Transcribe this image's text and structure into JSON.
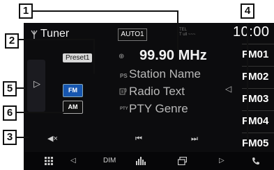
{
  "header": {
    "source_title": "Tuner",
    "auto_badge": "AUTO1",
    "status_line1": "TEL",
    "status_line2": "T ull ~~~",
    "clock": "10:00"
  },
  "main": {
    "preset_label": "Preset1",
    "frequency": "99.90 MHz",
    "ps_icon_label": "PS",
    "station_name": "Station Name",
    "radio_text": "Radio Text",
    "pty_icon_label": "PTY",
    "pty_genre": "PTY Genre"
  },
  "band_buttons": {
    "fm": "FM",
    "am": "AM"
  },
  "preset_list": {
    "items": [
      "FM01",
      "FM02",
      "FM03",
      "FM04",
      "FM05"
    ]
  },
  "controls": {
    "mute": "◀×",
    "prev": "⏮",
    "next": "⏭"
  },
  "bottom_bar": {
    "dim_label": "DIM"
  },
  "callouts": [
    "1",
    "2",
    "3",
    "4",
    "5",
    "6"
  ],
  "colors": {
    "band_active": "#1656b0",
    "screen_bg": "#0c0c0e"
  }
}
